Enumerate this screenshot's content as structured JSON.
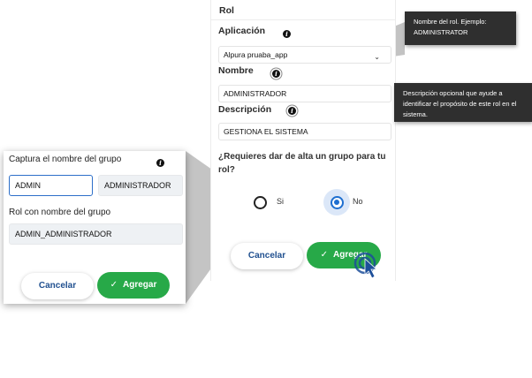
{
  "form": {
    "section_title": "Rol",
    "aplicacion_label": "Aplicación",
    "aplicacion_value": "Alpura pruaba_app",
    "nombre_label": "Nombre",
    "nombre_value": "ADMINISTRADOR",
    "descripcion_label": "Descripción",
    "descripcion_value": "GESTIONA EL SISTEMA",
    "question": "¿Requieres dar de alta un grupo para tu rol?",
    "radio_si_label": "Si",
    "radio_no_label": "No",
    "radio_selected": "No",
    "cancel_label": "Cancelar",
    "submit_label": "Agregar",
    "info_glyph": "i"
  },
  "tooltips": {
    "nombre": "Nombre del rol. Ejemplo: ADMINISTRATOR",
    "descripcion": "Descripción opcional que ayude a identificar el propósito de este rol en el sistema."
  },
  "zoom": {
    "captura_label": "Captura el nombre del grupo",
    "group_input_value": "ADMIN",
    "role_readonly_value": "ADMINISTRADOR",
    "rol_grupo_label": "Rol con nombre del grupo",
    "rol_grupo_value": "ADMIN_ADMINISTRADOR",
    "cancel_label": "Cancelar",
    "submit_label": "Agregar"
  },
  "colors": {
    "primary_green": "#27a948",
    "radio_blue": "#1e6fd0",
    "tooltip_bg": "#2f2f2f",
    "cursor_blue": "#1d4f9a"
  },
  "icons": {
    "info": "info-icon",
    "select_caret": "chevron-down-icon",
    "button_check": "checkmark-icon",
    "cursor": "click-cursor-icon"
  }
}
